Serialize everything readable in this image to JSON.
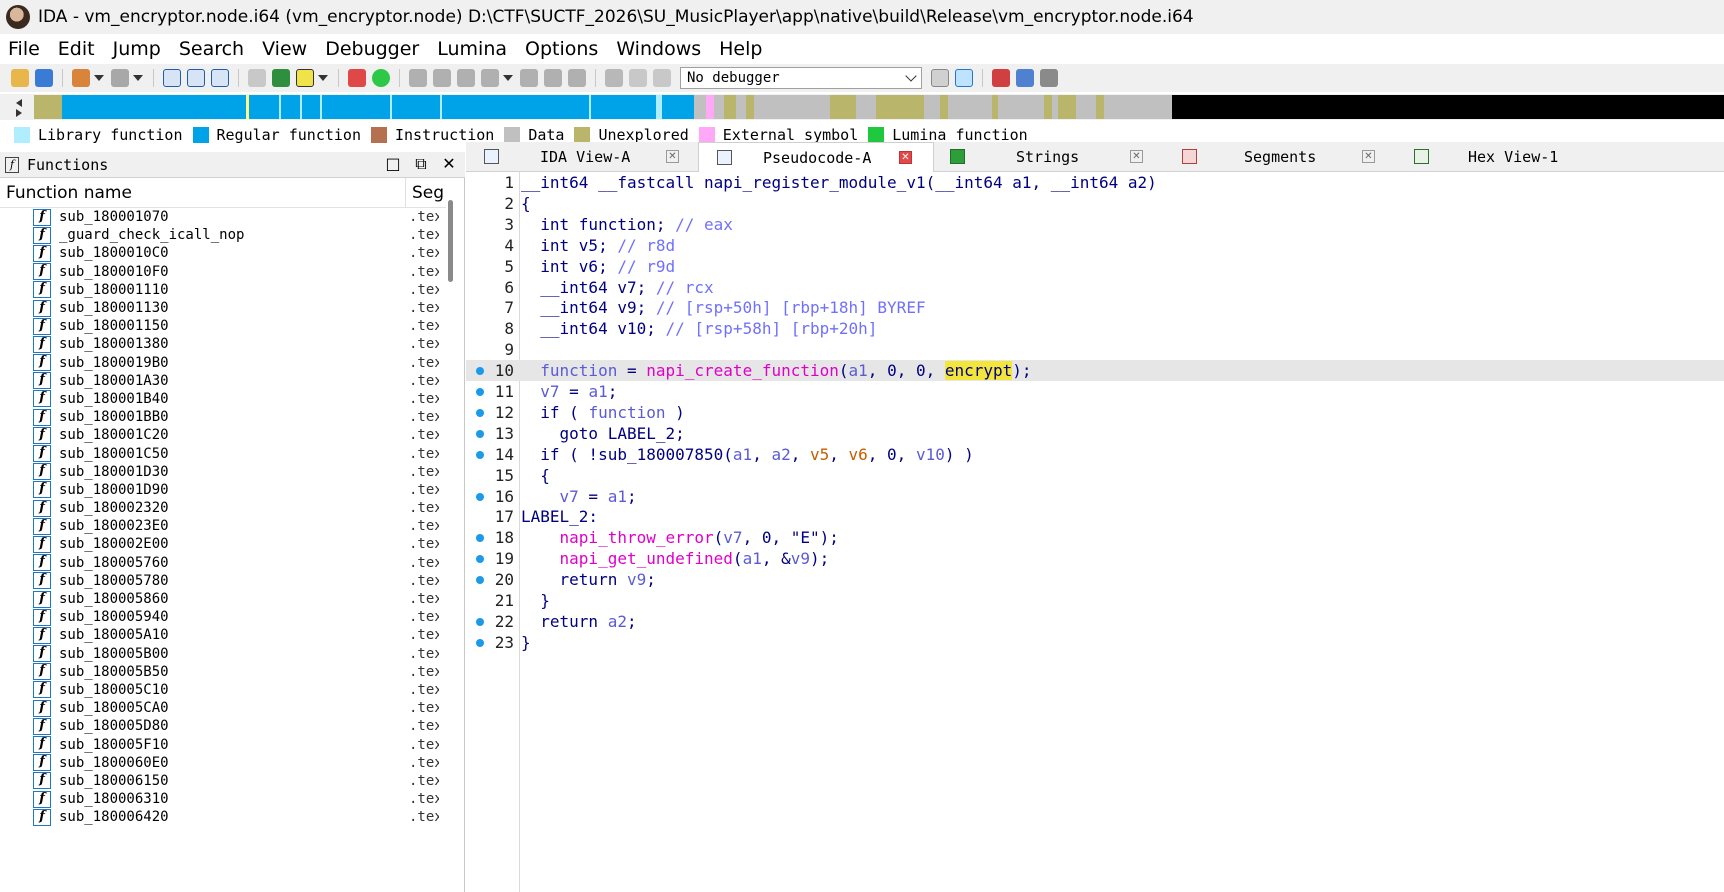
{
  "window": {
    "title": "IDA - vm_encryptor.node.i64 (vm_encryptor.node) D:\\CTF\\SUCTF_2026\\SU_MusicPlayer\\app\\native\\build\\Release\\vm_encryptor.node.i64"
  },
  "menu": [
    "File",
    "Edit",
    "Jump",
    "Search",
    "View",
    "Debugger",
    "Lumina",
    "Options",
    "Windows",
    "Help"
  ],
  "toolbar": {
    "debugger_select": "No debugger"
  },
  "legend": [
    {
      "label": "Library function",
      "color": "#aeeeff"
    },
    {
      "label": "Regular function",
      "color": "#00a2e8"
    },
    {
      "label": "Instruction",
      "color": "#b5704f"
    },
    {
      "label": "Data",
      "color": "#c0c0c0"
    },
    {
      "label": "Unexplored",
      "color": "#b9b56b"
    },
    {
      "label": "External symbol",
      "color": "#ffa8f8"
    },
    {
      "label": "Lumina function",
      "color": "#20c840"
    }
  ],
  "functions_pane": {
    "title": "Functions",
    "col_name": "Function name",
    "col_seg": "Seg",
    "rows": [
      {
        "name": "sub_180001070",
        "seg": ".tex"
      },
      {
        "name": "_guard_check_icall_nop",
        "seg": ".tex"
      },
      {
        "name": "sub_1800010C0",
        "seg": ".tex"
      },
      {
        "name": "sub_1800010F0",
        "seg": ".tex"
      },
      {
        "name": "sub_180001110",
        "seg": ".tex"
      },
      {
        "name": "sub_180001130",
        "seg": ".tex"
      },
      {
        "name": "sub_180001150",
        "seg": ".tex"
      },
      {
        "name": "sub_180001380",
        "seg": ".tex"
      },
      {
        "name": "sub_1800019B0",
        "seg": ".tex"
      },
      {
        "name": "sub_180001A30",
        "seg": ".tex"
      },
      {
        "name": "sub_180001B40",
        "seg": ".tex"
      },
      {
        "name": "sub_180001BB0",
        "seg": ".tex"
      },
      {
        "name": "sub_180001C20",
        "seg": ".tex"
      },
      {
        "name": "sub_180001C50",
        "seg": ".tex"
      },
      {
        "name": "sub_180001D30",
        "seg": ".tex"
      },
      {
        "name": "sub_180001D90",
        "seg": ".tex"
      },
      {
        "name": "sub_180002320",
        "seg": ".tex"
      },
      {
        "name": "sub_1800023E0",
        "seg": ".tex"
      },
      {
        "name": "sub_180002E00",
        "seg": ".tex"
      },
      {
        "name": "sub_180005760",
        "seg": ".tex"
      },
      {
        "name": "sub_180005780",
        "seg": ".tex"
      },
      {
        "name": "sub_180005860",
        "seg": ".tex"
      },
      {
        "name": "sub_180005940",
        "seg": ".tex"
      },
      {
        "name": "sub_180005A10",
        "seg": ".tex"
      },
      {
        "name": "sub_180005B00",
        "seg": ".tex"
      },
      {
        "name": "sub_180005B50",
        "seg": ".tex"
      },
      {
        "name": "sub_180005C10",
        "seg": ".tex"
      },
      {
        "name": "sub_180005CA0",
        "seg": ".tex"
      },
      {
        "name": "sub_180005D80",
        "seg": ".tex"
      },
      {
        "name": "sub_180005F10",
        "seg": ".tex"
      },
      {
        "name": "sub_1800060E0",
        "seg": ".tex"
      },
      {
        "name": "sub_180006150",
        "seg": ".tex"
      },
      {
        "name": "sub_180006310",
        "seg": ".tex"
      },
      {
        "name": "sub_180006420",
        "seg": ".tex"
      }
    ]
  },
  "tabs": [
    {
      "label": "IDA View-A",
      "active": false
    },
    {
      "label": "Pseudocode-A",
      "active": true
    },
    {
      "label": "Strings",
      "active": false
    },
    {
      "label": "Segments",
      "active": false
    },
    {
      "label": "Hex View-1",
      "active": false
    }
  ],
  "code": [
    {
      "n": "1",
      "bp": false,
      "hl": false,
      "parts": [
        [
          "plain",
          "__int64 __fastcall napi_register_module_v1(__int64 a1, __int64 a2)"
        ]
      ]
    },
    {
      "n": "2",
      "bp": false,
      "hl": false,
      "parts": [
        [
          "plain",
          "{"
        ]
      ]
    },
    {
      "n": "3",
      "bp": false,
      "hl": false,
      "parts": [
        [
          "plain",
          "  int function; "
        ],
        [
          "cmt",
          "// eax"
        ]
      ]
    },
    {
      "n": "4",
      "bp": false,
      "hl": false,
      "parts": [
        [
          "plain",
          "  int v5; "
        ],
        [
          "cmt",
          "// r8d"
        ]
      ]
    },
    {
      "n": "5",
      "bp": false,
      "hl": false,
      "parts": [
        [
          "plain",
          "  int v6; "
        ],
        [
          "cmt",
          "// r9d"
        ]
      ]
    },
    {
      "n": "6",
      "bp": false,
      "hl": false,
      "parts": [
        [
          "plain",
          "  __int64 v7; "
        ],
        [
          "cmt",
          "// rcx"
        ]
      ]
    },
    {
      "n": "7",
      "bp": false,
      "hl": false,
      "parts": [
        [
          "plain",
          "  __int64 v9; "
        ],
        [
          "cmt",
          "// [rsp+50h] [rbp+18h] BYREF"
        ]
      ]
    },
    {
      "n": "8",
      "bp": false,
      "hl": false,
      "parts": [
        [
          "plain",
          "  __int64 v10; "
        ],
        [
          "cmt",
          "// [rsp+58h] [rbp+20h]"
        ]
      ]
    },
    {
      "n": "9",
      "bp": false,
      "hl": false,
      "parts": [
        [
          "plain",
          ""
        ]
      ]
    },
    {
      "n": "10",
      "bp": true,
      "hl": true,
      "parts": [
        [
          "plain",
          "  "
        ],
        [
          "lv",
          "function"
        ],
        [
          "plain",
          " = "
        ],
        [
          "fn",
          "napi_create_function"
        ],
        [
          "plain",
          "("
        ],
        [
          "lv",
          "a1"
        ],
        [
          "plain",
          ", 0, 0, "
        ],
        [
          "enc",
          "encrypt"
        ],
        [
          "plain",
          ");"
        ]
      ]
    },
    {
      "n": "11",
      "bp": true,
      "hl": false,
      "parts": [
        [
          "plain",
          "  "
        ],
        [
          "lv",
          "v7"
        ],
        [
          "plain",
          " = "
        ],
        [
          "lv",
          "a1"
        ],
        [
          "plain",
          ";"
        ]
      ]
    },
    {
      "n": "12",
      "bp": true,
      "hl": false,
      "parts": [
        [
          "plain",
          "  if ( "
        ],
        [
          "lv",
          "function"
        ],
        [
          "plain",
          " )"
        ]
      ]
    },
    {
      "n": "13",
      "bp": true,
      "hl": false,
      "parts": [
        [
          "plain",
          "    goto LABEL_2;"
        ]
      ]
    },
    {
      "n": "14",
      "bp": true,
      "hl": false,
      "parts": [
        [
          "plain",
          "  if ( !sub_180007850("
        ],
        [
          "lv",
          "a1"
        ],
        [
          "plain",
          ", "
        ],
        [
          "lv",
          "a2"
        ],
        [
          "plain",
          ", "
        ],
        [
          "reg",
          "v5"
        ],
        [
          "plain",
          ", "
        ],
        [
          "reg",
          "v6"
        ],
        [
          "plain",
          ", 0, "
        ],
        [
          "lv",
          "v10"
        ],
        [
          "plain",
          ") )"
        ]
      ]
    },
    {
      "n": "15",
      "bp": false,
      "hl": false,
      "parts": [
        [
          "plain",
          "  {"
        ]
      ]
    },
    {
      "n": "16",
      "bp": true,
      "hl": false,
      "parts": [
        [
          "plain",
          "    "
        ],
        [
          "lv",
          "v7"
        ],
        [
          "plain",
          " = "
        ],
        [
          "lv",
          "a1"
        ],
        [
          "plain",
          ";"
        ]
      ]
    },
    {
      "n": "17",
      "bp": false,
      "hl": false,
      "parts": [
        [
          "plain",
          "LABEL_2:"
        ]
      ]
    },
    {
      "n": "18",
      "bp": true,
      "hl": false,
      "parts": [
        [
          "plain",
          "    "
        ],
        [
          "fn",
          "napi_throw_error"
        ],
        [
          "plain",
          "("
        ],
        [
          "lv",
          "v7"
        ],
        [
          "plain",
          ", 0, \"E\");"
        ]
      ]
    },
    {
      "n": "19",
      "bp": true,
      "hl": false,
      "parts": [
        [
          "plain",
          "    "
        ],
        [
          "fn",
          "napi_get_undefined"
        ],
        [
          "plain",
          "("
        ],
        [
          "lv",
          "a1"
        ],
        [
          "plain",
          ", &"
        ],
        [
          "lv",
          "v9"
        ],
        [
          "plain",
          ");"
        ]
      ]
    },
    {
      "n": "20",
      "bp": true,
      "hl": false,
      "parts": [
        [
          "plain",
          "    return "
        ],
        [
          "lv",
          "v9"
        ],
        [
          "plain",
          ";"
        ]
      ]
    },
    {
      "n": "21",
      "bp": false,
      "hl": false,
      "parts": [
        [
          "plain",
          "  }"
        ]
      ]
    },
    {
      "n": "22",
      "bp": true,
      "hl": false,
      "parts": [
        [
          "plain",
          "  return "
        ],
        [
          "lv",
          "a2"
        ],
        [
          "plain",
          ";"
        ]
      ]
    },
    {
      "n": "23",
      "bp": true,
      "hl": false,
      "parts": [
        [
          "plain",
          "}"
        ]
      ]
    }
  ]
}
